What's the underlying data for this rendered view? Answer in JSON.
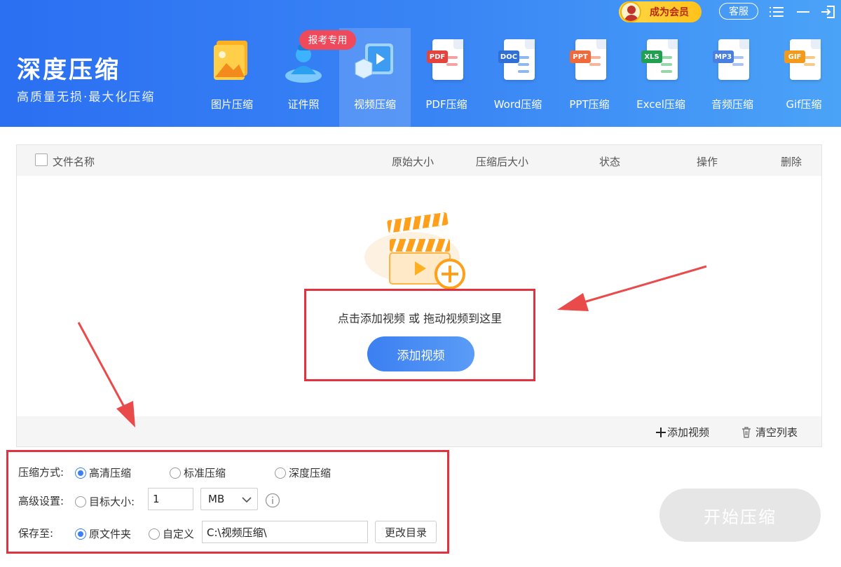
{
  "app": {
    "title": "深度压缩",
    "subtitle": "高质量无损·最大化压缩"
  },
  "topbar": {
    "vip_label": "成为会员",
    "service_label": "客服"
  },
  "promo_badge": "报考专用",
  "tabs": [
    {
      "label": "图片压缩",
      "icon": "image-icon"
    },
    {
      "label": "证件照",
      "icon": "id-photo-icon"
    },
    {
      "label": "视频压缩",
      "icon": "video-icon",
      "active": true
    },
    {
      "label": "PDF压缩",
      "icon": "pdf-icon",
      "tag": "PDF"
    },
    {
      "label": "Word压缩",
      "icon": "word-icon",
      "tag": "DOC"
    },
    {
      "label": "PPT压缩",
      "icon": "ppt-icon",
      "tag": "PPT"
    },
    {
      "label": "Excel压缩",
      "icon": "excel-icon",
      "tag": "XLS"
    },
    {
      "label": "音频压缩",
      "icon": "audio-icon",
      "tag": "MP3"
    },
    {
      "label": "Gif压缩",
      "icon": "gif-icon",
      "tag": "GIF"
    }
  ],
  "table": {
    "headers": {
      "name": "文件名称",
      "original_size": "原始大小",
      "compressed_size": "压缩后大小",
      "status": "状态",
      "action": "操作",
      "delete": "删除"
    }
  },
  "drop_zone": {
    "hint": "点击添加视频 或 拖动视频到这里",
    "button": "添加视频"
  },
  "panel_footer": {
    "add_label": "添加视频",
    "clear_label": "清空列表"
  },
  "settings": {
    "mode_label": "压缩方式:",
    "mode_options": [
      "高清压缩",
      "标准压缩",
      "深度压缩"
    ],
    "advanced_label": "高级设置:",
    "target_label": "目标大小:",
    "target_value": "1",
    "unit_value": "MB",
    "save_label": "保存至:",
    "save_options": [
      "原文件夹",
      "自定义"
    ],
    "path_value": "C:\\视频压缩\\",
    "change_dir": "更改目录"
  },
  "start_button": "开始压缩",
  "colors": {
    "header_start": "#2b6ff2",
    "header_end": "#4ba3f7",
    "accent": "#3b7ff2",
    "highlight": "#e0323f",
    "vip": "#ffc21a"
  }
}
